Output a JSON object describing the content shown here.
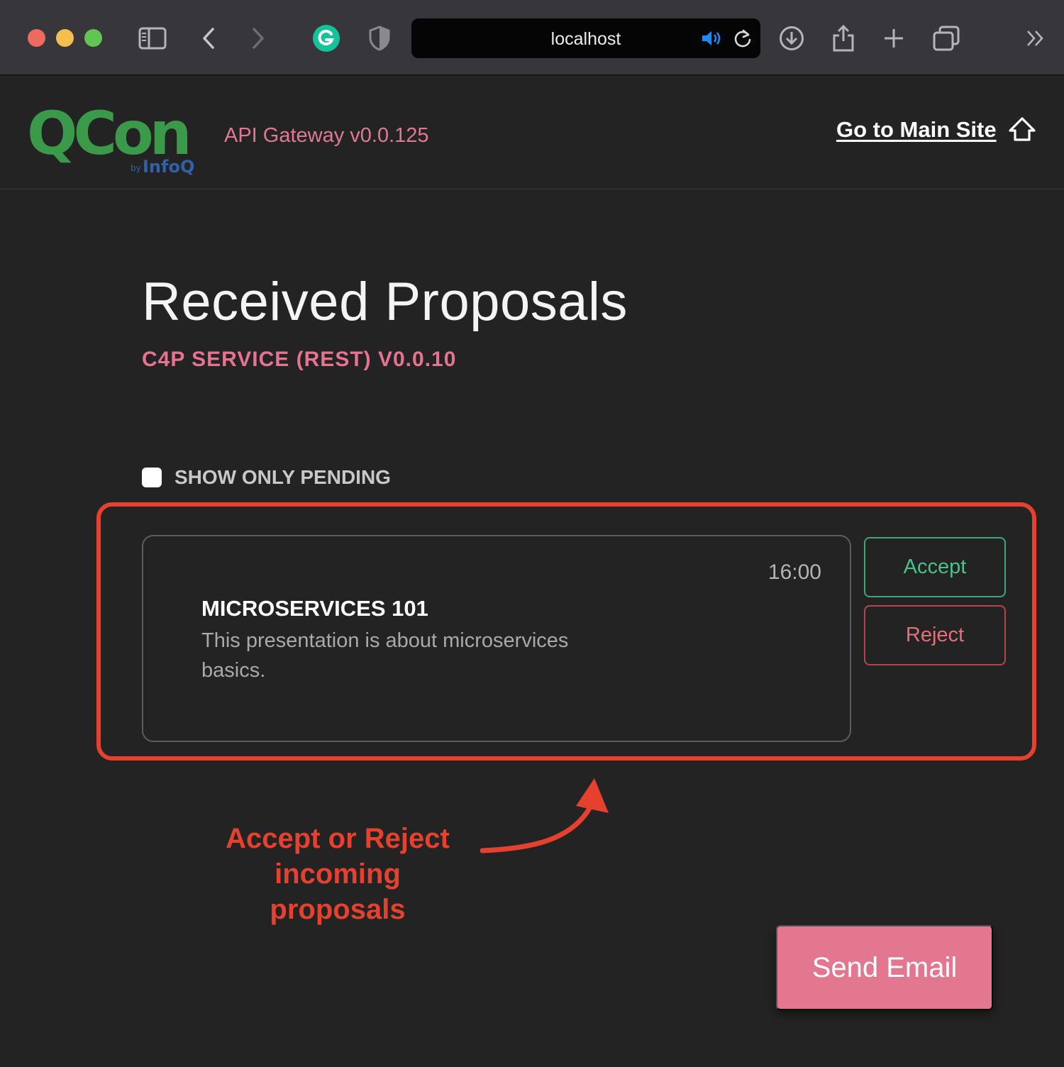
{
  "browser": {
    "url": "localhost",
    "toolbar_icons": [
      "sidebar-icon",
      "back-icon",
      "forward-icon",
      "grammarly-icon",
      "shield-icon",
      "audio-icon",
      "reload-icon",
      "download-icon",
      "share-icon",
      "new-tab-icon",
      "tabs-overview-icon",
      "more-icon"
    ]
  },
  "header": {
    "logo_text": "QCon",
    "logo_sub_by": "by",
    "logo_sub_brand": "InfoQ",
    "gateway_version": "API Gateway v0.0.125",
    "main_site_link": "Go to Main Site"
  },
  "main": {
    "title": "Received Proposals",
    "subtitle": "C4P SERVICE (REST) V0.0.10",
    "filter": {
      "label": "SHOW ONLY PENDING",
      "checked": false
    },
    "proposals": [
      {
        "time": "16:00",
        "title": "MICROSERVICES 101",
        "description": "This presentation is about microservices basics.",
        "accept_label": "Accept",
        "reject_label": "Reject"
      }
    ],
    "annotation": {
      "line1": "Accept or Reject",
      "line2": "incoming proposals"
    },
    "send_email_label": "Send Email"
  },
  "colors": {
    "accent_pink": "#e37790",
    "accept_green": "#4cc08a",
    "reject_red": "#e2707a",
    "annotation_red": "#e6412f",
    "logo_green": "#3a9a4a",
    "logo_blue": "#2f62a8"
  }
}
